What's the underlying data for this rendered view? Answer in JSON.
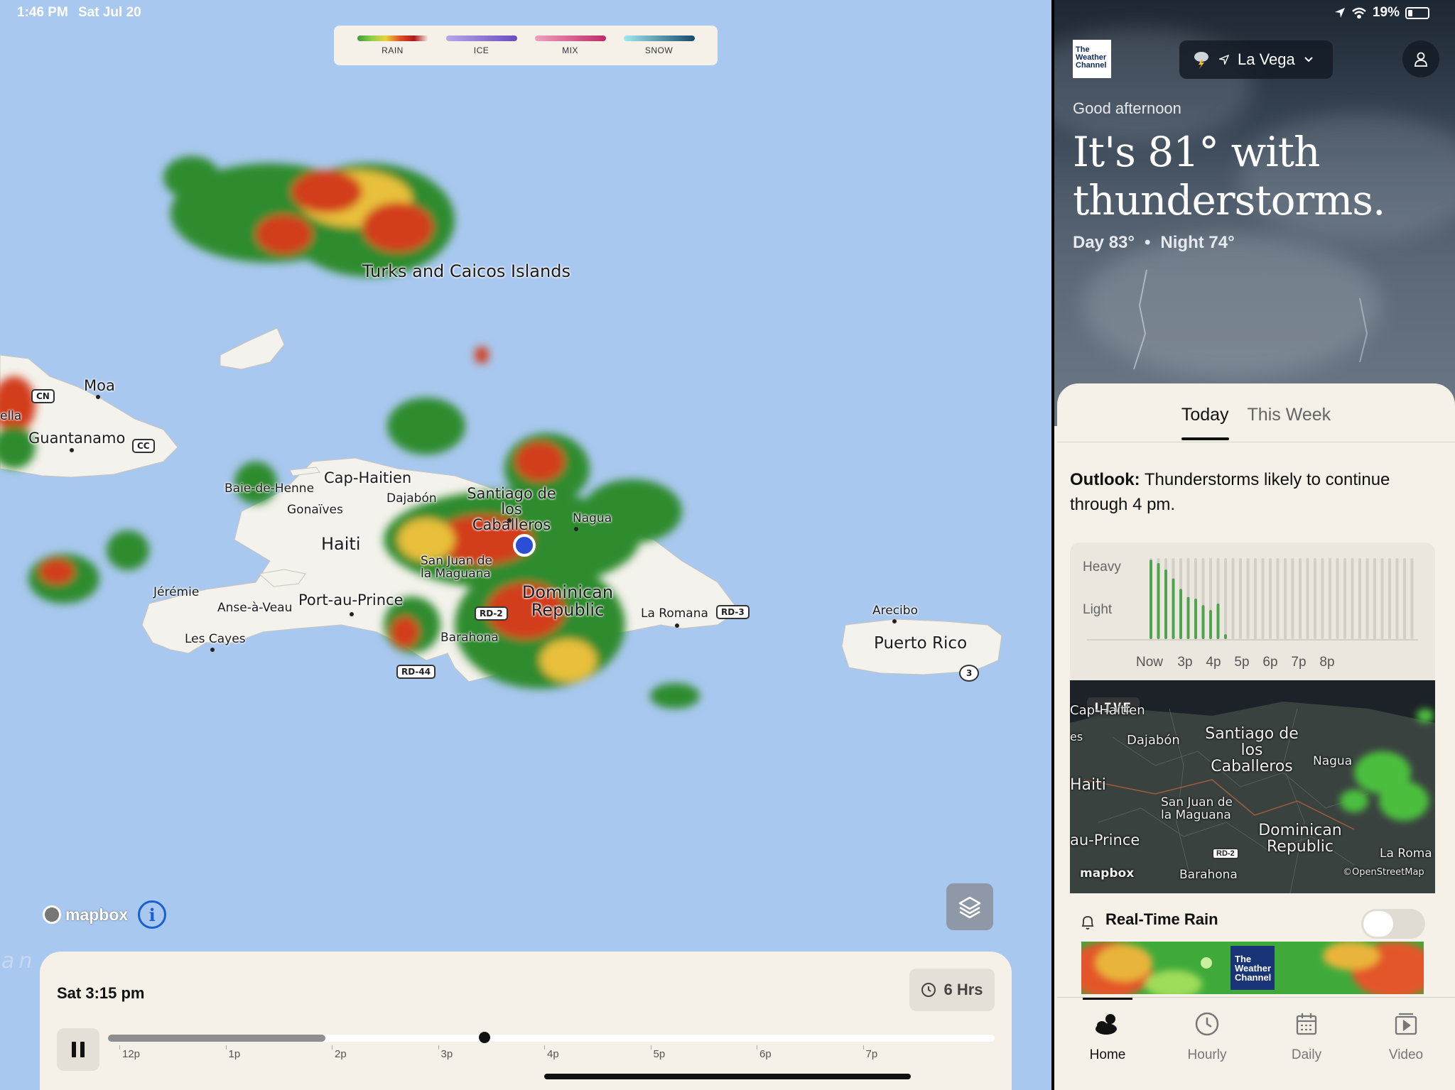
{
  "status_bar": {
    "time": "1:46 PM",
    "date": "Sat Jul 20",
    "battery": "19%"
  },
  "legend": {
    "items": [
      {
        "label": "RAIN",
        "gradient": [
          "#3a9b3a",
          "#8fcf4a",
          "#e8d23c",
          "#e0502a",
          "#b01818"
        ]
      },
      {
        "label": "ICE",
        "gradient": [
          "#b6a8e8",
          "#6a4cc0"
        ]
      },
      {
        "label": "MIX",
        "gradient": [
          "#f0a0c0",
          "#c02a6a"
        ]
      },
      {
        "label": "SNOW",
        "gradient": [
          "#9fe8f0",
          "#1a4a6a"
        ]
      }
    ]
  },
  "map": {
    "labels": {
      "turks_caicos": "Turks and Caicos Islands",
      "moa": "Moa",
      "guantanamo": "Guantanamo",
      "ella": "ella",
      "cap_haitien": "Cap-Haitien",
      "baie_de_henne": "Baie-de-Henne",
      "gonaives": "Gonaïves",
      "dajabon": "Dajabón",
      "santiago": "Santiago de los Caballeros",
      "nagua": "Nagua",
      "haiti": "Haiti",
      "san_juan": "San Juan de la Maguana",
      "jeremie": "Jérémie",
      "anse_a_veau": "Anse-à-Veau",
      "port_au_prince": "Port-au-Prince",
      "dominican_republic": "Dominican Republic",
      "la_romana": "La Romana",
      "les_cayes": "Les Cayes",
      "barahona": "Barahona",
      "arecibo": "Arecibo",
      "puerto_rico": "Puerto Rico",
      "ocean": "an"
    },
    "shields": {
      "cn": "CN",
      "cc": "CC",
      "rd2": "RD-2",
      "rd3": "RD-3",
      "rd44": "RD-44",
      "route3": "3"
    },
    "attribution": "mapbox",
    "info_icon": "i"
  },
  "timeline": {
    "current_time": "Sat 3:15 pm",
    "duration": "6 Hrs",
    "progress": 0.245,
    "playhead": 0.425,
    "ticks": [
      "12p",
      "1p",
      "2p",
      "3p",
      "4p",
      "5p",
      "6p",
      "7p"
    ]
  },
  "side": {
    "brand": "The Weather Channel",
    "location": "La Vega",
    "greeting": "Good afternoon",
    "headline": "It's 81° with thunderstorms.",
    "day": "Day 83°",
    "separator": "•",
    "night": "Night 74°",
    "tabs": [
      "Today",
      "This Week"
    ],
    "outlook_label": "Outlook:",
    "outlook_text": "Thunderstorms likely to continue through 4 pm.",
    "rain_chart": {
      "y_labels": [
        "Heavy",
        "Light"
      ],
      "x_labels": [
        "Now",
        "3p",
        "4p",
        "5p",
        "6p",
        "7p",
        "8p"
      ],
      "intensity": [
        0.98,
        0.94,
        0.86,
        0.75,
        0.62,
        0.52,
        0.5,
        0.42,
        0.36,
        0.44,
        0.06,
        0,
        0,
        0,
        0,
        0,
        0,
        0,
        0,
        0,
        0,
        0,
        0,
        0,
        0,
        0,
        0,
        0,
        0,
        0,
        0,
        0,
        0,
        0,
        0,
        0
      ]
    },
    "radar": {
      "live": "LIVE",
      "labels": {
        "cap": "Cap-Haitien",
        "es": "es",
        "dajabon": "Dajabón",
        "santiago": "Santiago de los Caballeros",
        "nagua": "Nagua",
        "haiti": "Haiti",
        "san_juan": "San Juan de la Maguana",
        "port_au_prince": "au-Prince",
        "dominican_republic": "Dominican Republic",
        "la_romana": "La Roma",
        "barahona": "Barahona",
        "mapbox": "mapbox",
        "osm": "©OpenStreetMap",
        "rd2": "RD-2"
      }
    },
    "realtime_rain": "Real-Time Rain",
    "ad_brand": "The Weather Channel",
    "tabbar": [
      "Home",
      "Hourly",
      "Daily",
      "Video"
    ]
  }
}
